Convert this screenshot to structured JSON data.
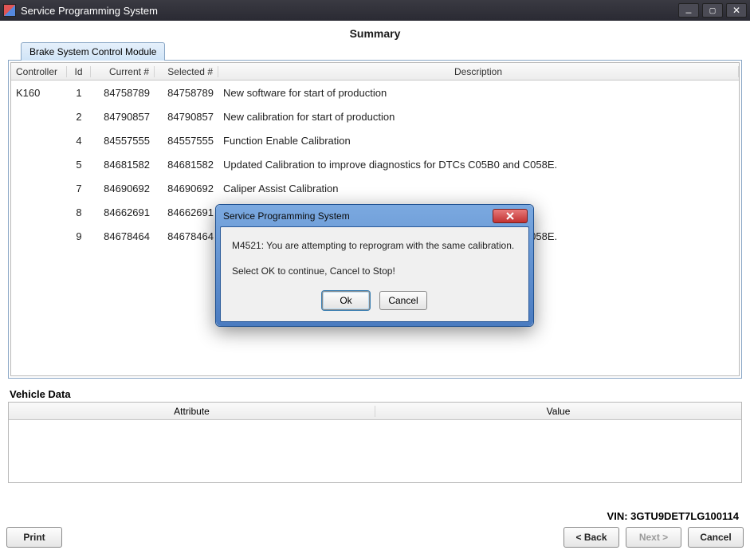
{
  "window": {
    "title": "Service Programming System",
    "min_icon": "_",
    "max_icon": "☐",
    "close_icon": "✕"
  },
  "main": {
    "summary_title": "Summary",
    "tab_label": "Brake System Control Module",
    "columns": {
      "controller": "Controller",
      "id": "Id",
      "current": "Current #",
      "selected": "Selected #",
      "description": "Description"
    },
    "rows": [
      {
        "controller": "K160",
        "id": "1",
        "current": "84758789",
        "selected": "84758789",
        "desc": "New software for start of production"
      },
      {
        "controller": "",
        "id": "2",
        "current": "84790857",
        "selected": "84790857",
        "desc": "New calibration for start of production"
      },
      {
        "controller": "",
        "id": "4",
        "current": "84557555",
        "selected": "84557555",
        "desc": "Function Enable Calibration"
      },
      {
        "controller": "",
        "id": "5",
        "current": "84681582",
        "selected": "84681582",
        "desc": "Updated Calibration to improve diagnostics for DTCs C05B0 and C058E."
      },
      {
        "controller": "",
        "id": "7",
        "current": "84690692",
        "selected": "84690692",
        "desc": "Caliper Assist Calibration"
      },
      {
        "controller": "",
        "id": "8",
        "current": "84662691",
        "selected": "84662691",
        "desc": ""
      },
      {
        "controller": "",
        "id": "9",
        "current": "84678464",
        "selected": "84678464",
        "desc": "Updated Calibration to improve diagnostics for DTCs C05B0 and C058E."
      }
    ]
  },
  "vehicle": {
    "section_label": "Vehicle Data",
    "attr_header": "Attribute",
    "value_header": "Value"
  },
  "vin_line": "VIN: 3GTU9DET7LG100114",
  "footer": {
    "print": "Print",
    "back": "< Back",
    "next": "Next >",
    "cancel": "Cancel"
  },
  "dialog": {
    "title": "Service Programming System",
    "line1": "M4521: You are attempting to reprogram with the same calibration.",
    "line2": "Select OK to continue, Cancel to Stop!",
    "ok": "Ok",
    "cancel": "Cancel"
  }
}
